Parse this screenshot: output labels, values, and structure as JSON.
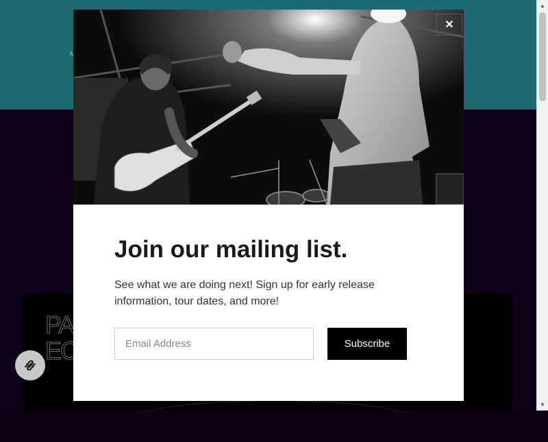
{
  "background": {
    "nav_fragment": "M",
    "logo_lines": [
      "PA",
      "EC"
    ],
    "colors": {
      "header": "#1e6a73",
      "body": "#10011a",
      "card": "#000000"
    }
  },
  "badge": {
    "icon": "squarespace-logo-icon"
  },
  "modal": {
    "close_label": "✕",
    "photo": {
      "icon": "band-performance-photo"
    },
    "title": "Join our mailing list.",
    "description": "See what we are doing next! Sign up for early release information, tour dates, and more!",
    "email_placeholder": "Email Address",
    "email_value": "",
    "subscribe_label": "Subscribe"
  },
  "scrollbar": {
    "up": "▲",
    "down": "▼"
  }
}
